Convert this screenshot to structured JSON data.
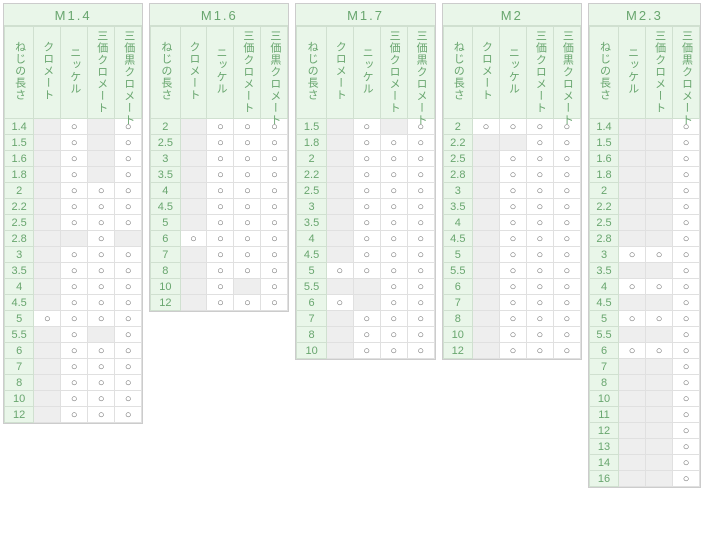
{
  "mark": "○",
  "tables": [
    {
      "id": "m14",
      "title": "M1.4",
      "row_header": "ねじの長さ",
      "col_headers": [
        "クロメート",
        "ニッケル",
        "三価クロメート",
        "三価黒クロメート"
      ],
      "rows": [
        {
          "len": "1.4",
          "cells": [
            0,
            1,
            0,
            1
          ]
        },
        {
          "len": "1.5",
          "cells": [
            0,
            1,
            0,
            1
          ]
        },
        {
          "len": "1.6",
          "cells": [
            0,
            1,
            0,
            1
          ]
        },
        {
          "len": "1.8",
          "cells": [
            0,
            1,
            0,
            1
          ]
        },
        {
          "len": "2",
          "cells": [
            0,
            1,
            1,
            1
          ]
        },
        {
          "len": "2.2",
          "cells": [
            0,
            1,
            1,
            1
          ]
        },
        {
          "len": "2.5",
          "cells": [
            0,
            1,
            1,
            1
          ]
        },
        {
          "len": "2.8",
          "cells": [
            0,
            0,
            1,
            0
          ]
        },
        {
          "len": "3",
          "cells": [
            0,
            1,
            1,
            1
          ]
        },
        {
          "len": "3.5",
          "cells": [
            0,
            1,
            1,
            1
          ]
        },
        {
          "len": "4",
          "cells": [
            0,
            1,
            1,
            1
          ]
        },
        {
          "len": "4.5",
          "cells": [
            0,
            1,
            1,
            1
          ]
        },
        {
          "len": "5",
          "cells": [
            1,
            1,
            1,
            1
          ]
        },
        {
          "len": "5.5",
          "cells": [
            0,
            1,
            0,
            1
          ]
        },
        {
          "len": "6",
          "cells": [
            0,
            1,
            1,
            1
          ]
        },
        {
          "len": "7",
          "cells": [
            0,
            1,
            1,
            1
          ]
        },
        {
          "len": "8",
          "cells": [
            0,
            1,
            1,
            1
          ]
        },
        {
          "len": "10",
          "cells": [
            0,
            1,
            1,
            1
          ]
        },
        {
          "len": "12",
          "cells": [
            0,
            1,
            1,
            1
          ]
        }
      ]
    },
    {
      "id": "m16",
      "title": "M1.6",
      "row_header": "ねじの長さ",
      "col_headers": [
        "クロメート",
        "ニッケル",
        "三価クロメート",
        "三価黒クロメート"
      ],
      "rows": [
        {
          "len": "2",
          "cells": [
            0,
            1,
            1,
            1
          ]
        },
        {
          "len": "2.5",
          "cells": [
            0,
            1,
            1,
            1
          ]
        },
        {
          "len": "3",
          "cells": [
            0,
            1,
            1,
            1
          ]
        },
        {
          "len": "3.5",
          "cells": [
            0,
            1,
            1,
            1
          ]
        },
        {
          "len": "4",
          "cells": [
            0,
            1,
            1,
            1
          ]
        },
        {
          "len": "4.5",
          "cells": [
            0,
            1,
            1,
            1
          ]
        },
        {
          "len": "5",
          "cells": [
            0,
            1,
            1,
            1
          ]
        },
        {
          "len": "6",
          "cells": [
            1,
            1,
            1,
            1
          ]
        },
        {
          "len": "7",
          "cells": [
            0,
            1,
            1,
            1
          ]
        },
        {
          "len": "8",
          "cells": [
            0,
            1,
            1,
            1
          ]
        },
        {
          "len": "10",
          "cells": [
            0,
            1,
            0,
            1
          ]
        },
        {
          "len": "12",
          "cells": [
            0,
            1,
            1,
            1
          ]
        }
      ]
    },
    {
      "id": "m17",
      "title": "M1.7",
      "row_header": "ねじの長さ",
      "col_headers": [
        "クロメート",
        "ニッケル",
        "三価クロメート",
        "三価黒クロメート"
      ],
      "rows": [
        {
          "len": "1.5",
          "cells": [
            0,
            1,
            0,
            1
          ]
        },
        {
          "len": "1.8",
          "cells": [
            0,
            1,
            1,
            1
          ]
        },
        {
          "len": "2",
          "cells": [
            0,
            1,
            1,
            1
          ]
        },
        {
          "len": "2.2",
          "cells": [
            0,
            1,
            1,
            1
          ]
        },
        {
          "len": "2.5",
          "cells": [
            0,
            1,
            1,
            1
          ]
        },
        {
          "len": "3",
          "cells": [
            0,
            1,
            1,
            1
          ]
        },
        {
          "len": "3.5",
          "cells": [
            0,
            1,
            1,
            1
          ]
        },
        {
          "len": "4",
          "cells": [
            0,
            1,
            1,
            1
          ]
        },
        {
          "len": "4.5",
          "cells": [
            0,
            1,
            1,
            1
          ]
        },
        {
          "len": "5",
          "cells": [
            1,
            1,
            1,
            1
          ]
        },
        {
          "len": "5.5",
          "cells": [
            0,
            0,
            1,
            1
          ]
        },
        {
          "len": "6",
          "cells": [
            1,
            0,
            1,
            1
          ]
        },
        {
          "len": "7",
          "cells": [
            0,
            1,
            1,
            1
          ]
        },
        {
          "len": "8",
          "cells": [
            0,
            1,
            1,
            1
          ]
        },
        {
          "len": "10",
          "cells": [
            0,
            1,
            1,
            1
          ]
        }
      ]
    },
    {
      "id": "m2",
      "title": "M2",
      "row_header": "ねじの長さ",
      "col_headers": [
        "クロメート",
        "ニッケル",
        "三価クロメート",
        "三価黒クロメート"
      ],
      "rows": [
        {
          "len": "2",
          "cells": [
            1,
            1,
            1,
            1
          ]
        },
        {
          "len": "2.2",
          "cells": [
            0,
            0,
            1,
            1
          ]
        },
        {
          "len": "2.5",
          "cells": [
            0,
            1,
            1,
            1
          ]
        },
        {
          "len": "2.8",
          "cells": [
            0,
            1,
            1,
            1
          ]
        },
        {
          "len": "3",
          "cells": [
            0,
            1,
            1,
            1
          ]
        },
        {
          "len": "3.5",
          "cells": [
            0,
            1,
            1,
            1
          ]
        },
        {
          "len": "4",
          "cells": [
            0,
            1,
            1,
            1
          ]
        },
        {
          "len": "4.5",
          "cells": [
            0,
            1,
            1,
            1
          ]
        },
        {
          "len": "5",
          "cells": [
            0,
            1,
            1,
            1
          ]
        },
        {
          "len": "5.5",
          "cells": [
            0,
            1,
            1,
            1
          ]
        },
        {
          "len": "6",
          "cells": [
            0,
            1,
            1,
            1
          ]
        },
        {
          "len": "7",
          "cells": [
            0,
            1,
            1,
            1
          ]
        },
        {
          "len": "8",
          "cells": [
            0,
            1,
            1,
            1
          ]
        },
        {
          "len": "10",
          "cells": [
            0,
            1,
            1,
            1
          ]
        },
        {
          "len": "12",
          "cells": [
            0,
            1,
            1,
            1
          ]
        }
      ]
    },
    {
      "id": "m23",
      "title": "M2.3",
      "row_header": "ねじの長さ",
      "col_headers": [
        "ニッケル",
        "三価クロメート",
        "三価黒クロメート"
      ],
      "rows": [
        {
          "len": "1.4",
          "cells": [
            0,
            0,
            1
          ]
        },
        {
          "len": "1.5",
          "cells": [
            0,
            0,
            1
          ]
        },
        {
          "len": "1.6",
          "cells": [
            0,
            0,
            1
          ]
        },
        {
          "len": "1.8",
          "cells": [
            0,
            0,
            1
          ]
        },
        {
          "len": "2",
          "cells": [
            0,
            0,
            1
          ]
        },
        {
          "len": "2.2",
          "cells": [
            0,
            0,
            1
          ]
        },
        {
          "len": "2.5",
          "cells": [
            0,
            0,
            1
          ]
        },
        {
          "len": "2.8",
          "cells": [
            0,
            0,
            1
          ]
        },
        {
          "len": "3",
          "cells": [
            1,
            1,
            1
          ]
        },
        {
          "len": "3.5",
          "cells": [
            0,
            0,
            1
          ]
        },
        {
          "len": "4",
          "cells": [
            1,
            1,
            1
          ]
        },
        {
          "len": "4.5",
          "cells": [
            0,
            0,
            1
          ]
        },
        {
          "len": "5",
          "cells": [
            1,
            1,
            1
          ]
        },
        {
          "len": "5.5",
          "cells": [
            0,
            0,
            1
          ]
        },
        {
          "len": "6",
          "cells": [
            1,
            1,
            1
          ]
        },
        {
          "len": "7",
          "cells": [
            0,
            0,
            1
          ]
        },
        {
          "len": "8",
          "cells": [
            0,
            0,
            1
          ]
        },
        {
          "len": "10",
          "cells": [
            0,
            0,
            1
          ]
        },
        {
          "len": "11",
          "cells": [
            0,
            0,
            1
          ]
        },
        {
          "len": "12",
          "cells": [
            0,
            0,
            1
          ]
        },
        {
          "len": "13",
          "cells": [
            0,
            0,
            1
          ]
        },
        {
          "len": "14",
          "cells": [
            0,
            0,
            1
          ]
        },
        {
          "len": "16",
          "cells": [
            0,
            0,
            1
          ]
        }
      ]
    }
  ]
}
